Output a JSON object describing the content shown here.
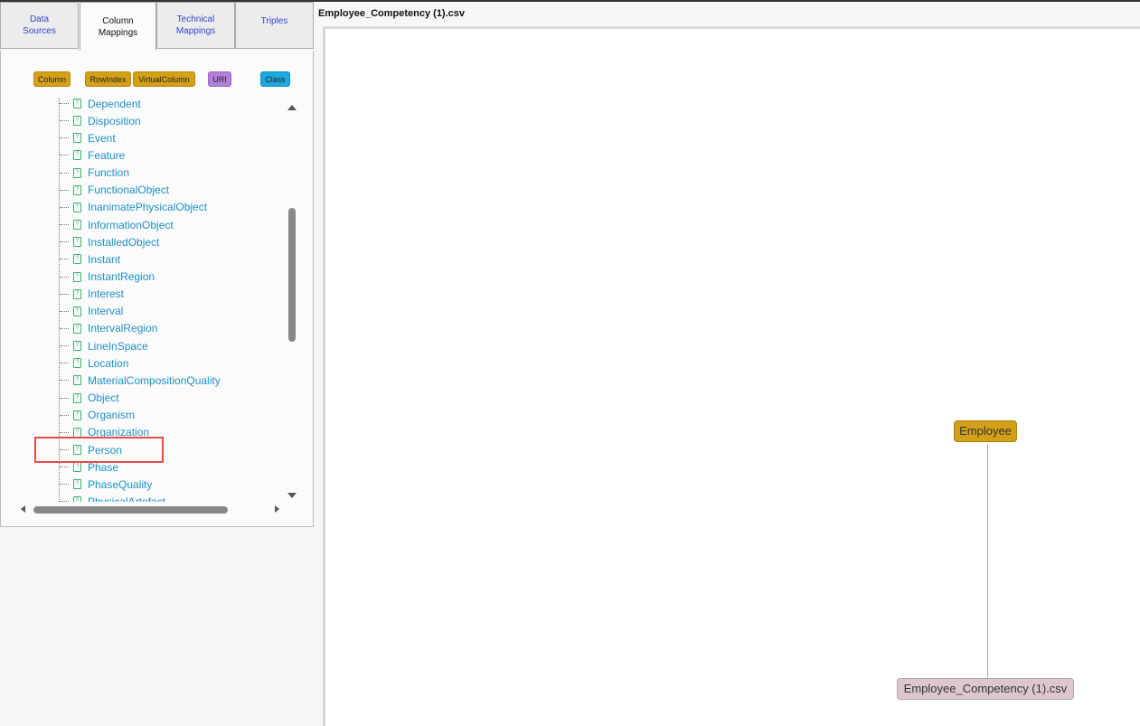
{
  "tabs": [
    {
      "label": "Data\nSources",
      "active": false
    },
    {
      "label": "Column\nMappings",
      "active": true
    },
    {
      "label": "Technical\nMappings",
      "active": false
    },
    {
      "label": "Triples",
      "active": false
    }
  ],
  "legend": {
    "column": "Column",
    "rowindex": "RowIndex",
    "virtualcolumn": "VirtualColumn",
    "uri": "URI",
    "class": "Class"
  },
  "colors": {
    "column": "#d4a017",
    "uri": "#b57edc",
    "class": "#1ea8e0",
    "tree_text": "#1e90c8",
    "highlight": "#e84a4a",
    "employee_node": "#d4a017",
    "csv_node": "#dcc8cc"
  },
  "tree": {
    "items": [
      "Dependent",
      "Disposition",
      "Event",
      "Feature",
      "Function",
      "FunctionalObject",
      "InanimatePhysicalObject",
      "InformationObject",
      "InstalledObject",
      "Instant",
      "InstantRegion",
      "Interest",
      "Interval",
      "IntervalRegion",
      "LineInSpace",
      "Location",
      "MaterialCompositionQuality",
      "Object",
      "Organism",
      "Organization",
      "Person",
      "Phase",
      "PhaseQuality",
      "PhysicalArtefact"
    ],
    "highlighted": "Person",
    "icon": "file-icon"
  },
  "file_title": "Employee_Competency (1).csv",
  "graph": {
    "class_node": "Employee",
    "source_node": "Employee_Competency (1).csv"
  }
}
